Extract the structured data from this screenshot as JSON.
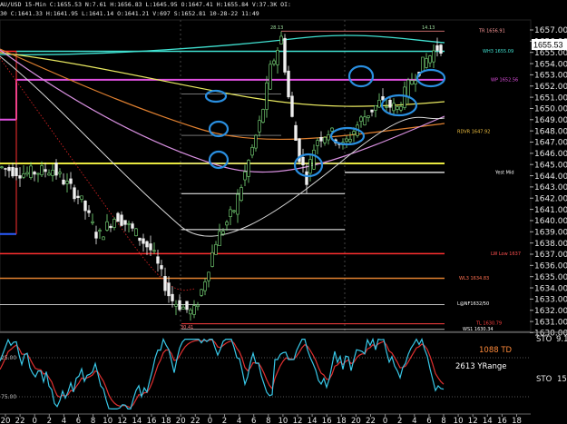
{
  "header": {
    "line1": "AU/USD  15-Min  C:1655.53  N:7.61  H:1656.83  L:1645.95  O:1647.41  H:1655.84  V:37.3K  OI:",
    "line2": "30  C:1641.33  H:1641.95  L:1641.14  O:1641.21  V:697  S:1652.81  10-28-22  11:49"
  },
  "price_axis": {
    "ticks": [
      "1657.00",
      "1656.00",
      "1655.00",
      "1654.00",
      "1653.00",
      "1652.00",
      "1651.00",
      "1650.00",
      "1649.00",
      "1648.00",
      "1647.00",
      "1646.00",
      "1645.00",
      "1644.00",
      "1643.00",
      "1642.00",
      "1641.00",
      "1640.00",
      "1639.00",
      "1638.00",
      "1637.00",
      "1636.00",
      "1635.00",
      "1634.00",
      "1633.00",
      "1632.00",
      "1631.00",
      "1630.00"
    ],
    "current_price": "1655.53"
  },
  "levels": [
    {
      "label": "28.13",
      "color": "#9fdf9f"
    },
    {
      "label": "14.13",
      "color": "#9fdf9f"
    },
    {
      "label": "TR 1656.91",
      "color": "#ff9a9a"
    },
    {
      "label": "WH3 1655.09",
      "color": "#40e0d0"
    },
    {
      "label": "WP 1652.56",
      "color": "#e050e0"
    },
    {
      "label": "RDVR 1647.92",
      "color": "#f0c040"
    },
    {
      "label": "Yest Mid",
      "color": "#ffffff"
    },
    {
      "label": "LW Low 1637",
      "color": "#ff5050"
    },
    {
      "label": "WL3 1634.83",
      "color": "#ff7050"
    },
    {
      "label": "L@NF1632/50",
      "color": "#ffffff"
    },
    {
      "label": "WS1 1630.34",
      "color": "#ffffff"
    },
    {
      "label": "TL 1630.79",
      "color": "#ff4040"
    },
    {
      "label": "30.41",
      "color": "#ff7070"
    }
  ],
  "stoch": {
    "label_top": "STO",
    "value_top": "9.1",
    "label_bottom": "STO",
    "value_bottom": "15",
    "td": "1088 TD",
    "yrange": "2613 YRange",
    "ticks": [
      "25.00",
      "75.00"
    ]
  },
  "time_axis": [
    "20",
    "22",
    "0",
    "2",
    "4",
    "6",
    "8",
    "10",
    "12",
    "14",
    "16",
    "18",
    "20",
    "22",
    "0",
    "2",
    "4",
    "6",
    "8",
    "10",
    "12",
    "14",
    "16",
    "18",
    "20",
    "22",
    "0",
    "2",
    "4",
    "6",
    "8",
    "10",
    "12",
    "14",
    "16",
    "18"
  ],
  "colors": {
    "background": "#000000",
    "bull": "#7de07d",
    "bear": "#f0f0f0",
    "circle": "#2a8fe0",
    "cyan": "#40e0d0",
    "magenta": "#e050e0",
    "yellow": "#e8e840",
    "orange": "#e08030",
    "red": "#ff3030",
    "stoch_k": "#38c8e8",
    "stoch_d": "#e03030"
  }
}
